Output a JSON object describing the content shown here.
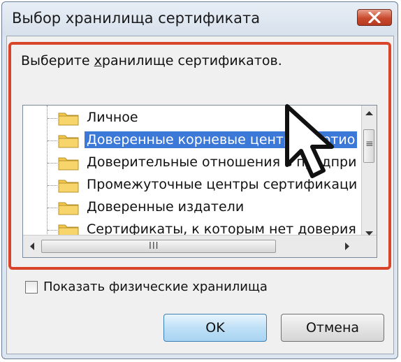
{
  "window": {
    "title": "Выбор хранилища сертификата"
  },
  "dialog": {
    "prompt_text": "Выберите хранилище сертификатов.",
    "prompt_prefix": "Выберите ",
    "prompt_hotkey": "х",
    "prompt_suffix": "ранилище сертификатов."
  },
  "tree": {
    "items": [
      {
        "label": "Личное",
        "selected": false
      },
      {
        "label": "Доверенные корневые центры сертио",
        "selected": true
      },
      {
        "label": "Доверительные отношения в предпри",
        "selected": false
      },
      {
        "label": "Промежуточные центры сертификаци",
        "selected": false
      },
      {
        "label": "Доверенные издатели",
        "selected": false
      },
      {
        "label": "Сертификаты, к которым нет доверия",
        "selected": false
      }
    ],
    "hscroll_grip": "III",
    "vscroll_grip": "≡"
  },
  "options": {
    "show_physical_label": "Показать физические хранилища",
    "show_physical_checked": false
  },
  "buttons": {
    "ok_label": "OK",
    "cancel_label": "Отмена"
  },
  "colors": {
    "highlight_frame": "#d9452b",
    "selection": "#3b78d8",
    "close_button": "#c84a2e",
    "folder": "#f2c94c"
  },
  "icons": {
    "close": "close-icon",
    "folder": "folder-icon",
    "cursor": "mouse-pointer-icon"
  }
}
